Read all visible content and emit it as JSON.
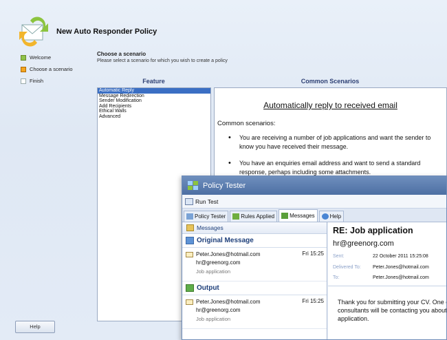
{
  "wizard": {
    "title": "New Auto Responder Policy",
    "steps": [
      {
        "label": "Welcome"
      },
      {
        "label": "Choose a scenario"
      },
      {
        "label": "Finish"
      }
    ],
    "scenario_heading": "Choose a scenario",
    "scenario_subtitle": "Please select a scenario for which you wish to create a policy",
    "feature_header": "Feature",
    "common_header": "Common Scenarios",
    "features": [
      "Automatic Reply",
      "Message Redirection",
      "Sender Modification",
      "Add Recipients",
      "Ethical Walls",
      "Advanced"
    ],
    "selected_feature": "Automatic Reply",
    "common_title": "Automatically reply to received email",
    "common_label": "Common scenarios:",
    "bullets": [
      "You are receiving a number of job applications and want the sender to know you have received their message.",
      "You have an enquiries email address and want to send a standard response, perhaps including some attachments."
    ],
    "help_button": "Help"
  },
  "tester": {
    "title": "Policy Tester",
    "run_test": "Run Test",
    "tabs": [
      "Policy Tester",
      "Rules Applied",
      "Messages",
      "Help"
    ],
    "active_tab": "Messages",
    "messages_header": "Messages",
    "original_section": "Original Message",
    "output_section": "Output",
    "original_msg": {
      "from": "Peter.Jones@hotmail.com",
      "time": "Fri 15:25",
      "to": "hr@greenorg.com",
      "subject": "Job application"
    },
    "output_msg": {
      "from": "Peter.Jones@hotmail.com",
      "time": "Fri 15:25",
      "to": "hr@greenorg.com",
      "subject": "Job application"
    },
    "preview": {
      "subject": "RE: Job application",
      "from": "hr@greenorg.com",
      "sent_label": "Sent:",
      "sent_value": "22 October 2011 15:25:08",
      "delivered_label": "Delivered To:",
      "delivered_value": "Peter.Jones@hotmail.com",
      "to_label": "To:",
      "to_value": "Peter.Jones@hotmail.com",
      "body": "Thank you for submitting your CV. One of our consultants will be contacting you about your application."
    }
  },
  "colors": {
    "accent": "#2d3f73",
    "titlebar": "#5a7bb0",
    "selection": "#3b6fc4"
  }
}
